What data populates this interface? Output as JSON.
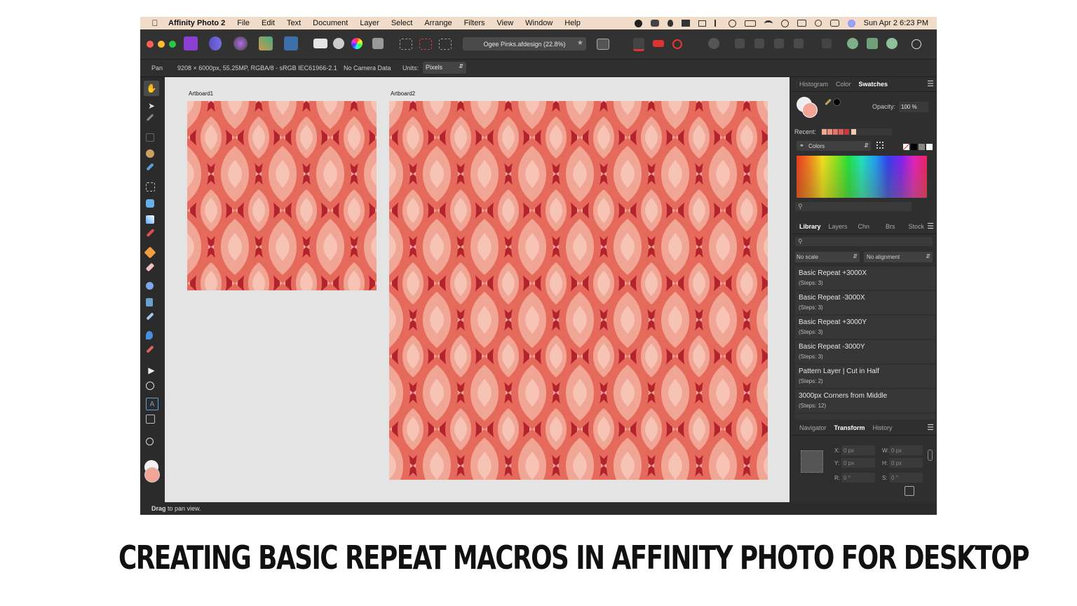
{
  "menubar": {
    "app_name": "Affinity Photo 2",
    "items": [
      "File",
      "Edit",
      "Text",
      "Document",
      "Layer",
      "Select",
      "Arrange",
      "Filters",
      "View",
      "Window",
      "Help"
    ],
    "clock": "Sun Apr 2  6:23 PM"
  },
  "toolbar": {
    "document_tab": "Ogee Pinks.afdesign (22.8%)"
  },
  "context_bar": {
    "tool": "Pan",
    "doc_info": "9208 × 6000px, 55.25MP, RGBA/8 - sRGB IEC61966-2.1",
    "camera": "No Camera Data",
    "units_label": "Units:",
    "units_value": "Pixels"
  },
  "canvas": {
    "artboard1_label": "Artboard1",
    "artboard2_label": "Artboard2"
  },
  "swatches_panel": {
    "tabs": [
      "Histogram",
      "Color",
      "Swatches"
    ],
    "active_tab": "Swatches",
    "opacity_label": "Opacity:",
    "opacity_value": "100 %",
    "recent_label": "Recent:",
    "recent_colors": [
      "#f0a896",
      "#e88f80",
      "#e27468",
      "#d85d58",
      "#c63a3a",
      "#eeccb0"
    ],
    "palette_name": "Colors"
  },
  "library_panel": {
    "tabs": [
      "Library",
      "Layers",
      "Chn",
      "Brs",
      "Stock"
    ],
    "active_tab": "Library",
    "scale_option": "No scale",
    "alignment_option": "No alignment",
    "items": [
      {
        "name": "Basic Repeat +3000X",
        "steps": "(Steps: 3)"
      },
      {
        "name": "Basic Repeat -3000X",
        "steps": "(Steps: 3)"
      },
      {
        "name": "Basic Repeat +3000Y",
        "steps": "(Steps: 3)"
      },
      {
        "name": "Basic Repeat -3000Y",
        "steps": "(Steps: 3)"
      },
      {
        "name": "Pattern Layer | Cut in Half",
        "steps": "(Steps: 2)"
      },
      {
        "name": "3000px Corners from Middle",
        "steps": "(Steps: 12)"
      }
    ]
  },
  "transform_panel": {
    "tabs": [
      "Navigator",
      "Transform",
      "History"
    ],
    "active_tab": "Transform",
    "x_label": "X:",
    "x_value": "0 px",
    "y_label": "Y:",
    "y_value": "0 px",
    "w_label": "W:",
    "w_value": "0 px",
    "h_label": "H:",
    "h_value": "0 px",
    "r_label": "R:",
    "r_value": "0 °",
    "s_label": "S:",
    "s_value": "0 °"
  },
  "status_bar": {
    "bold": "Drag",
    "text": " to pan view."
  },
  "caption": "CREATING BASIC REPEAT MACROS IN AFFINITY PHOTO FOR DESKTOP",
  "colors": {
    "pattern_dark": "#b3232e",
    "pattern_mid": "#e56a5c",
    "pattern_light": "#f1a594",
    "pattern_pale": "#f7c3b4"
  }
}
